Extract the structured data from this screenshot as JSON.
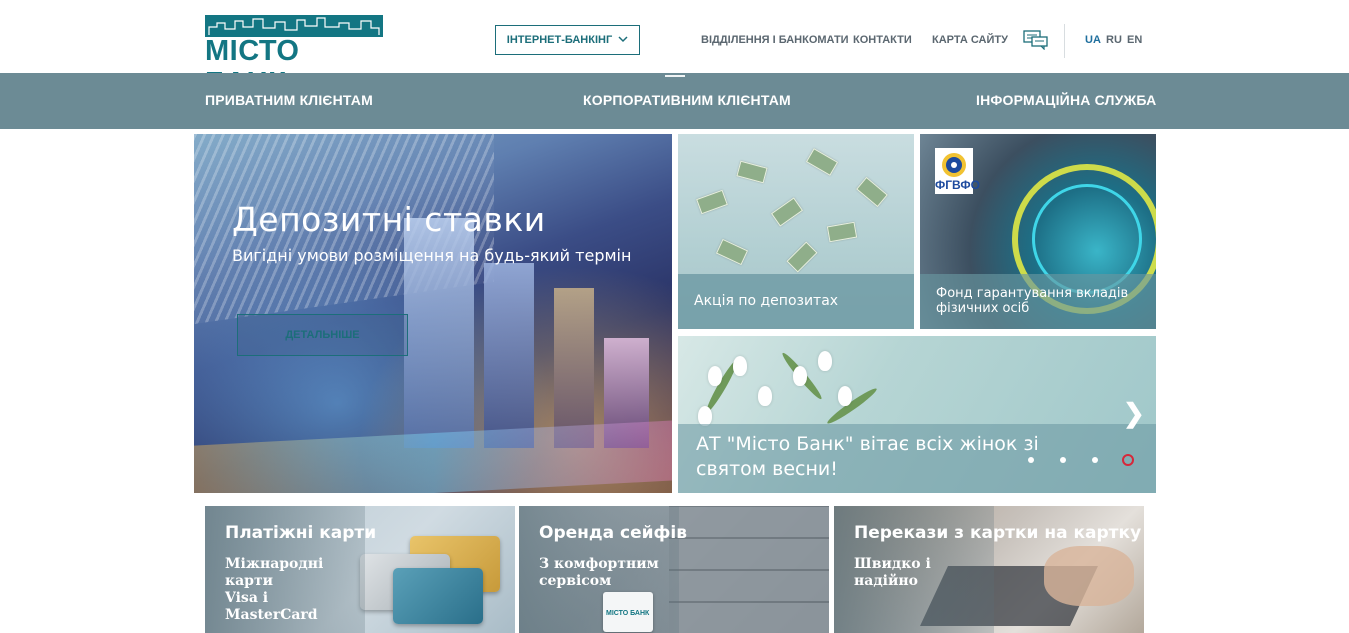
{
  "header": {
    "logo_text": "МІСТО БАНК",
    "internet_banking": "ІНТЕРНЕТ-БАНКІНГ",
    "links": [
      "ВІДДІЛЕННЯ І БАНКОМАТИ",
      "КОНТАКТИ",
      "КАРТА САЙТУ"
    ],
    "languages": [
      "UA",
      "RU",
      "EN"
    ],
    "active_language": "UA"
  },
  "nav": {
    "items": [
      "ПРИВАТНИМ КЛІЄНТАМ",
      "КОРПОРАТИВНИМ КЛІЄНТАМ",
      "ІНФОРМАЦІЙНА СЛУЖБА"
    ]
  },
  "hero": {
    "title": "Депозитні ставки",
    "subtitle": "Вигідні умови розміщення на будь-який термін",
    "button": "ДЕТАЛЬНІШЕ"
  },
  "tiles": {
    "deposit_promo": "Акція по депозитах",
    "fund_line1": "Фонд гарантування вкладів",
    "fund_line2": "фізичних осіб",
    "fund_logo": "ФГВФО"
  },
  "slider": {
    "text_line1": "АТ \"Місто Банк\" вітає всіх жінок зі",
    "text_line2": "святом весни!",
    "dots_count": 4,
    "active_dot": 4
  },
  "bottom": {
    "cards": {
      "title": "Платіжні карти",
      "line1": "Міжнародні карти",
      "line2": "Visa і",
      "line3": "MasterCard"
    },
    "safe": {
      "title": "Оренда сейфів",
      "line1": "З комфортним",
      "line2": "сервісом"
    },
    "transfer": {
      "title": "Перекази з картки на картку",
      "line1": "Швидко і",
      "line2": "надійно"
    }
  },
  "colors": {
    "brand": "#137683",
    "nav_bg": "#6c8b95",
    "active_dot": "#d6283a"
  }
}
